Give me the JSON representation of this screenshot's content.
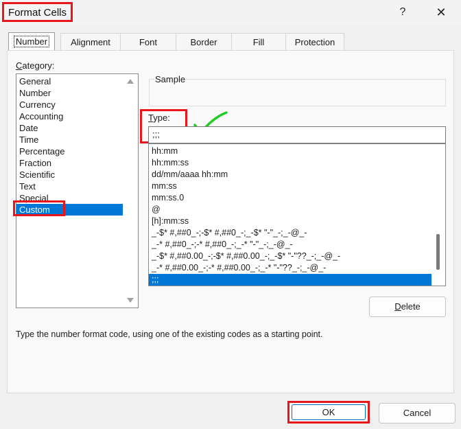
{
  "window": {
    "title": "Format Cells",
    "help_label": "?",
    "close_label": "✕"
  },
  "tabs": [
    "Number",
    "Alignment",
    "Font",
    "Border",
    "Fill",
    "Protection"
  ],
  "category": {
    "label": "Category:",
    "items": [
      "General",
      "Number",
      "Currency",
      "Accounting",
      "Date",
      "Time",
      "Percentage",
      "Fraction",
      "Scientific",
      "Text",
      "Special",
      "Custom"
    ],
    "selected": "Custom"
  },
  "sample": {
    "label": "Sample",
    "value": ""
  },
  "type": {
    "label": "Type:",
    "value": ";;;",
    "formats": [
      "hh:mm",
      "hh:mm:ss",
      "dd/mm/aaaa hh:mm",
      "mm:ss",
      "mm:ss.0",
      "@",
      "[h]:mm:ss",
      "_-$* #,##0_-;-$* #,##0_-;_-$* \"-\"_-;_-@_-",
      "_-* #,##0_-;-* #,##0_-;_-* \"-\"_-;_-@_-",
      "_-$* #,##0.00_-;-$* #,##0.00_-;_-$* \"-\"??_-;_-@_-",
      "_-* #,##0.00_-;-* #,##0.00_-;_-* \"-\"??_-;_-@_-",
      ";;;"
    ],
    "selected": ";;;"
  },
  "buttons": {
    "delete": "Delete",
    "ok": "OK",
    "cancel": "Cancel"
  },
  "description": "Type the number format code, using one of the existing codes as a starting point.",
  "colors": {
    "highlight_red": "#e8161b",
    "selection_blue": "#0078d7",
    "checkmark_green": "#22cc22"
  }
}
